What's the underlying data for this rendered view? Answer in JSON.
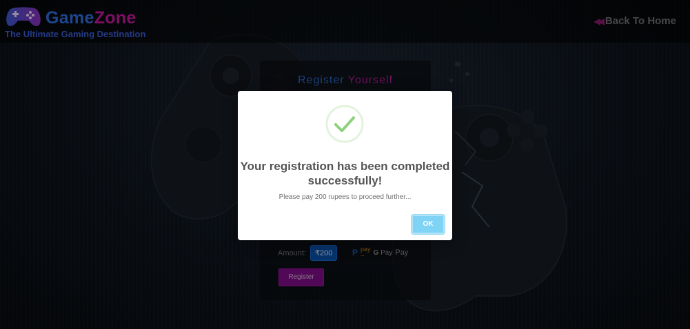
{
  "header": {
    "brand_part1": "Game",
    "brand_part2": "Zone",
    "tagline": "The Ultimate Gaming Destination",
    "back_link": "Back To Home",
    "logo_icon": "gamepad-icon",
    "back_icon": "double-chevron-left-icon"
  },
  "form": {
    "title_part1": "Register",
    "title_part2": "Yourself",
    "amount_label": "Amount:",
    "amount_value": "₹200",
    "payment_logos": [
      "PayPal",
      "amazon pay",
      "G Pay",
      "Apple Pay"
    ],
    "register_label": "Register"
  },
  "modal": {
    "icon": "checkmark-icon",
    "title": "Your registration has been completed successfully!",
    "message": "Please pay 200 rupees to proceed further...",
    "ok_label": "OK"
  },
  "colors": {
    "brand_blue": "#2f6ad9",
    "brand_magenta": "#c2179c",
    "success_green": "#8dd17d",
    "ok_button": "#7fd3f5",
    "register_button": "#7d0e86"
  }
}
